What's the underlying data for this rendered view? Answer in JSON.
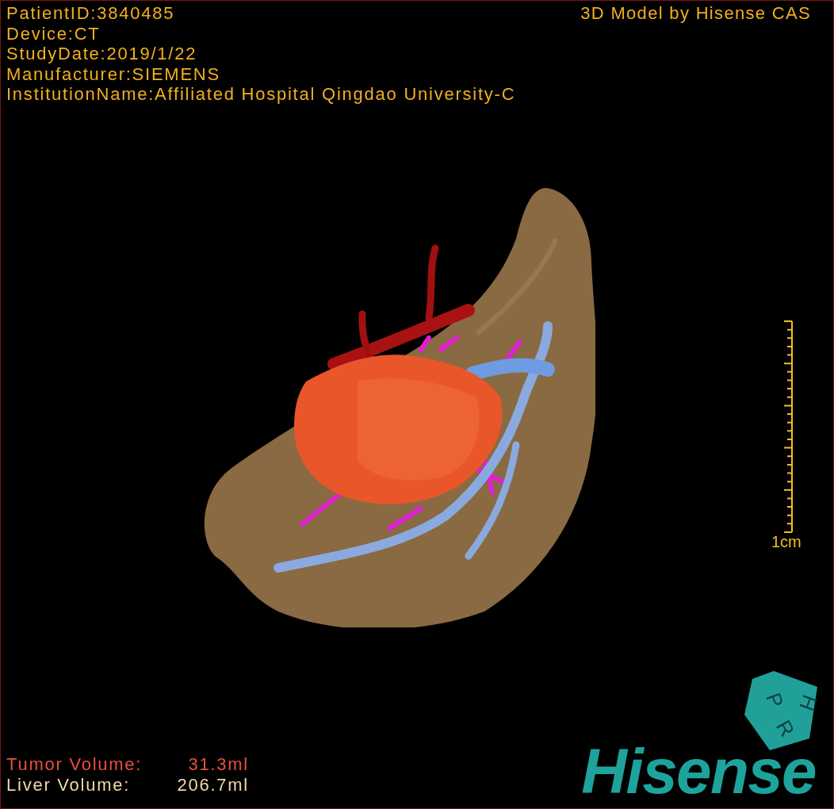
{
  "info_lines": [
    "PatientID:3840485",
    "Device:CT",
    "StudyDate:2019/1/22",
    "Manufacturer:SIEMENS",
    "InstitutionName:Affiliated Hospital Qingdao University-C"
  ],
  "credit": "3D Model by Hisense CAS",
  "scale_bar": {
    "label": "1cm"
  },
  "orientation_cube": {
    "faces": [
      "P",
      "H",
      "R"
    ]
  },
  "volumes": [
    {
      "label": "Tumor Volume:",
      "value": "31.3ml",
      "color": "#e8503a"
    },
    {
      "label": "Liver Volume:",
      "value": "206.7ml",
      "color": "#f0d8a8"
    }
  ],
  "logo": "Hisense"
}
